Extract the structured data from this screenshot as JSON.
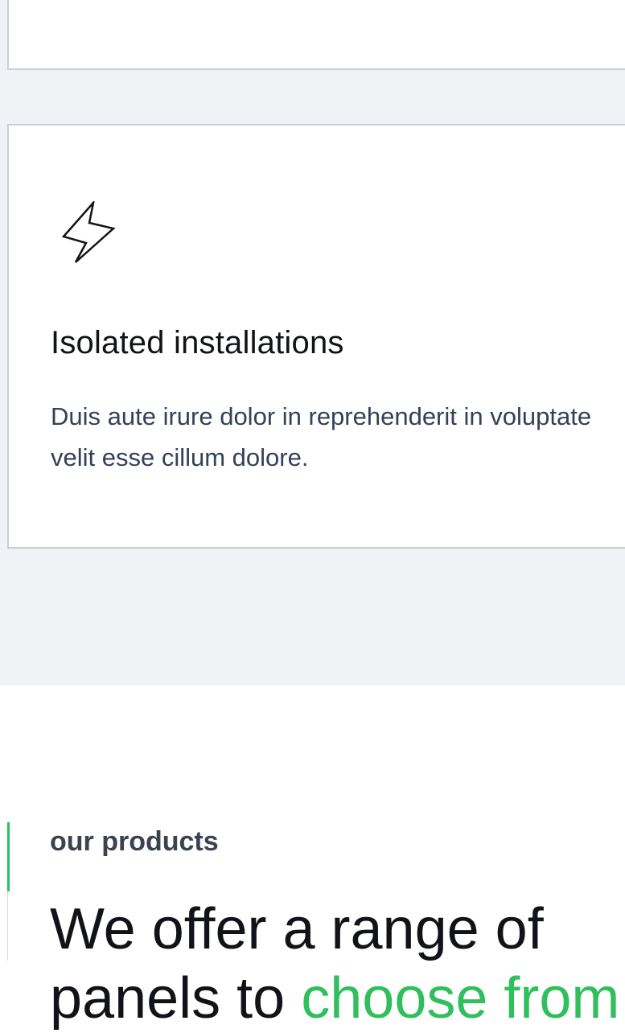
{
  "feature_card": {
    "icon": "lightning-bolt-icon",
    "title": "Isolated installations",
    "description": "Duis aute irure dolor in reprehenderit in voluptate velit esse cillum dolore."
  },
  "products": {
    "eyebrow": "our products",
    "headline_part1": "We offer a range of",
    "headline_part2": "panels to ",
    "headline_highlight": "choose from"
  },
  "colors": {
    "background_band": "#f0f2f6",
    "card_border": "#c9cfdc",
    "accent_green": "#22c55e",
    "body_text": "#344157",
    "heading_text": "#111318"
  }
}
